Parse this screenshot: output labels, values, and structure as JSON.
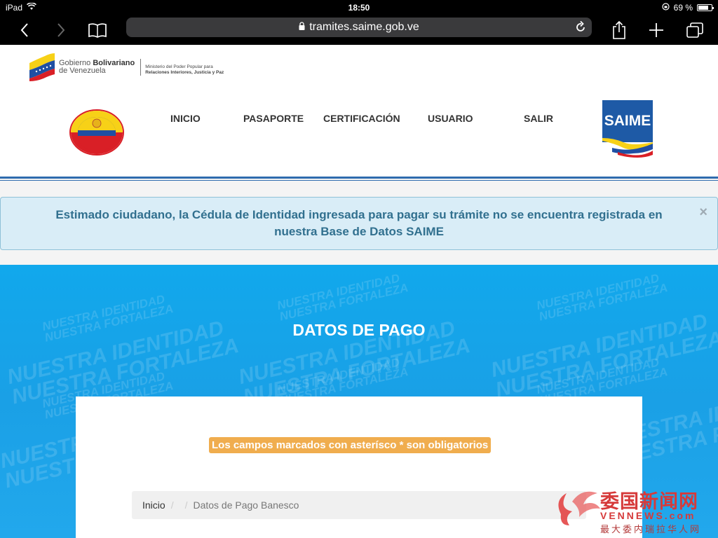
{
  "status_bar": {
    "device": "iPad",
    "time": "18:50",
    "battery": "69 %",
    "battery_level": 0.69
  },
  "browser": {
    "url": "tramites.saime.gob.ve"
  },
  "gov_header": {
    "gov_line1": "Gobierno ",
    "gov_line1_bold": "Bolivariano",
    "gov_line2": "de Venezuela",
    "ministry_line1": "Ministerio del Poder Popular para",
    "ministry_line2": "Relaciones Interiores, Justicia y Paz"
  },
  "nav": [
    "INICIO",
    "PASAPORTE",
    "CERTIFICACIÓN",
    "USUARIO",
    "SALIR"
  ],
  "saime_logo_text": "SAIME",
  "alert": {
    "message_line1": "Estimado ciudadano, la Cédula de Identidad ingresada para pagar su trámite no se encuentra registrada en",
    "message_line2": "nuestra Base de Datos SAIME",
    "close": "×"
  },
  "hero": {
    "title": "DATOS DE PAGO",
    "watermark_line1": "NUESTRA IDENTIDAD",
    "watermark_line2": "NUESTRA FORTALEZA"
  },
  "card": {
    "required_notice": "Los campos marcados con asterísco * son obligatorios",
    "breadcrumb": [
      "Inicio",
      "",
      "Datos de Pago Banesco"
    ]
  },
  "site_watermark": {
    "cn_name": "委国新闻网",
    "en_name": "VENNEWS.com",
    "tagline": "最大委内瑞拉华人网"
  },
  "colors": {
    "alert_text": "#31708f",
    "alert_bg": "#d9edf7",
    "hero_blue": "#1aa0e6",
    "notice_orange": "#f0ad4e",
    "saime_blue": "#1e5aa6"
  }
}
